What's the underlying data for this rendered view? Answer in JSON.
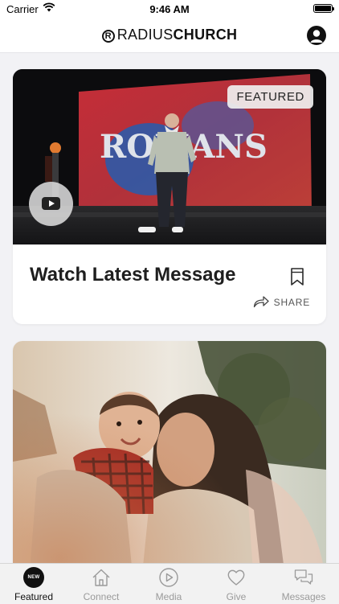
{
  "status_bar": {
    "carrier": "Carrier",
    "time": "9:46 AM"
  },
  "header": {
    "logo_mark": "R",
    "logo_light": "RADIUS",
    "logo_bold": "CHURCH"
  },
  "feed": {
    "featured_card": {
      "badge": "FEATURED",
      "title": "Watch Latest Message",
      "share_label": "SHARE",
      "slide_text": "ROMANS"
    }
  },
  "tabbar": {
    "new_badge": "NEW",
    "tabs": [
      {
        "label": "Featured",
        "icon": "new-icon",
        "active": true
      },
      {
        "label": "Connect",
        "icon": "house-icon",
        "active": false
      },
      {
        "label": "Media",
        "icon": "play-icon",
        "active": false
      },
      {
        "label": "Give",
        "icon": "heart-icon",
        "active": false
      },
      {
        "label": "Messages",
        "icon": "chat-bubbles-icon",
        "active": false
      }
    ]
  },
  "colors": {
    "active": "#111111",
    "inactive": "#9a9a9a",
    "background": "#f2f2f5"
  }
}
